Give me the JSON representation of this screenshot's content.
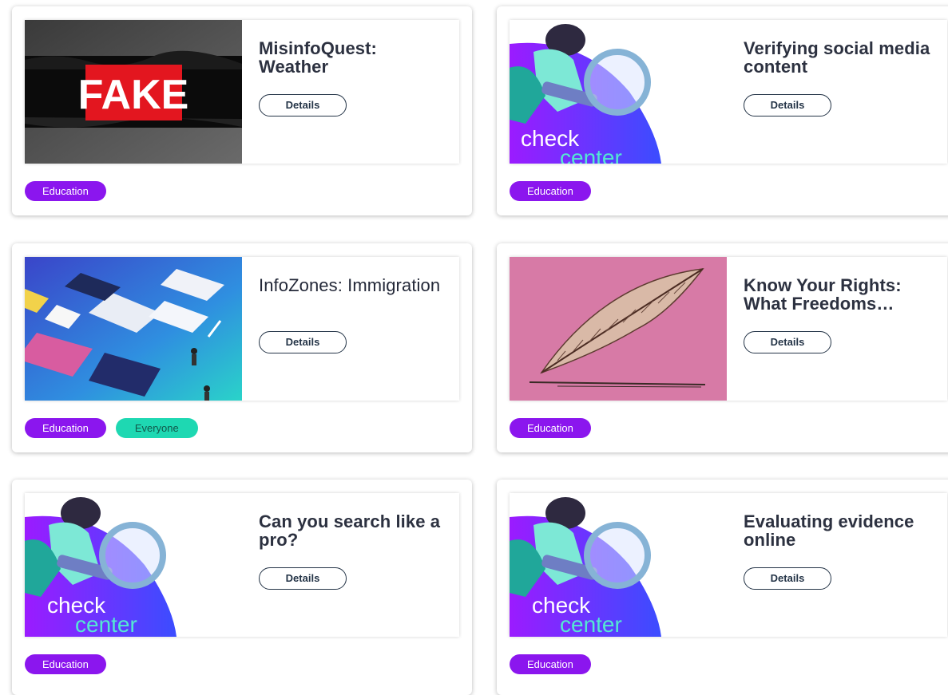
{
  "cards": [
    {
      "title": "MisinfoQuest: Weather",
      "details_label": "Details",
      "thumb_text": "FAKE",
      "tags": [
        "Education"
      ]
    },
    {
      "title": "Verifying social media content",
      "details_label": "Details",
      "thumb_text": "check center",
      "tags": [
        "Education"
      ]
    },
    {
      "title": "InfoZones: Immigration",
      "details_label": "Details",
      "tags": [
        "Education",
        "Everyone"
      ]
    },
    {
      "title": "Know Your Rights: What Freedoms…",
      "details_label": "Details",
      "tags": [
        "Education"
      ]
    },
    {
      "title": "Can you search like a pro?",
      "details_label": "Details",
      "thumb_text": "check center",
      "tags": [
        "Education"
      ]
    },
    {
      "title": "Evaluating evidence online",
      "details_label": "Details",
      "thumb_text": "check center",
      "tags": [
        "Education"
      ]
    }
  ],
  "colors": {
    "education_tag": "#8b16ee",
    "everyone_tag": "#1ed8b2",
    "title": "#2c3140",
    "button_border": "#243447"
  },
  "icons": [
    "fake-stamp-thumbnail",
    "checkcenter-magnifier-thumbnail",
    "isometric-apps-thumbnail",
    "quill-thumbnail"
  ]
}
